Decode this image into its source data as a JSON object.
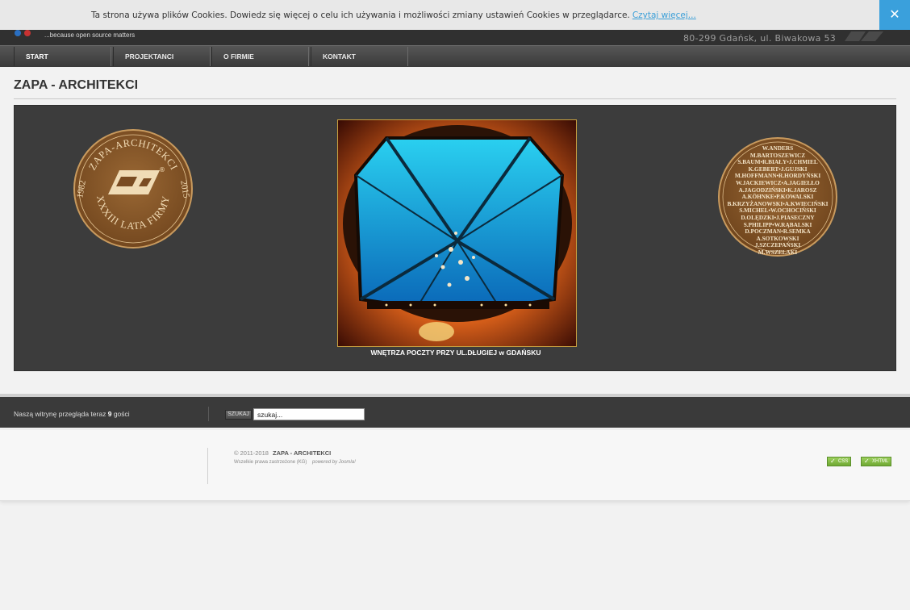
{
  "cookie": {
    "text": "Ta strona używa plików Cookies. Dowiedz się więcej o celu ich używania i możliwości zmiany ustawień Cookies w przeglądarce.",
    "link": "Czytaj więcej...",
    "close": "✕"
  },
  "header": {
    "tagline": "...because open source matters",
    "address": "80-299 Gdańsk, ul. Biwakowa 53"
  },
  "nav": {
    "items": [
      {
        "label": "START"
      },
      {
        "label": "PROJEKTANCI"
      },
      {
        "label": "O FIRMIE"
      },
      {
        "label": "KONTAKT"
      }
    ]
  },
  "main": {
    "title": "ZAPA - ARCHITEKCI",
    "caption": "WNĘTRZA POCZTY PRZY UL.DŁUGIEJ w GDAŃSKU",
    "seal_left": {
      "top_text": "ZAPA-ARCHITEKCI",
      "bottom_text": "XXXIII LATA FIRMY",
      "left_year": "1982",
      "right_year": "2015",
      "mark": "®"
    },
    "seal_right": {
      "names": [
        "W.ANDERS",
        "M.BARTOSZEWICZ",
        "S.BAUM•R.BIAŁY•J.CHMIEL",
        "K.GEBERT•J.GUJSKI",
        "M.HOFFMANN•R.HORDYŃSKI",
        "W.JACKIEWICZ•A.JAGIEŁŁO",
        "A.JAGODZIŃSKI•K.JAROSZ",
        "A.KÖHNKE•P.KOWALSKI",
        "B.KRZYŻANOWSKI•A.KWIECIŃSKI",
        "S.MICHEL•W.OCHOCIŃSKI",
        "D.OLĘDZKI•J.PIASECZNY",
        "S.PHILIPP•W.RĄBALSKI",
        "D.POCZMAN•R.SEMKA",
        "A.SOTKOWSKI",
        "J.SZCZEPAŃSKI",
        "M.WSZELAKI"
      ]
    }
  },
  "footer": {
    "visitors_prefix": "Naszą witrynę przegląda teraz",
    "visitors_count": "9",
    "visitors_suffix": "gości",
    "search_button": "SZUKAJ",
    "search_value": "szukaj...",
    "copyright_years": "© 2011-2018",
    "copyright_name": "ZAPA - ARCHITEKCI",
    "rights": "Wszelkie prawa zastrzeżone (KG)",
    "powered": "powered by Joomla!",
    "badge_css": "CSS",
    "badge_xhtml": "XHTML"
  },
  "colors": {
    "accent": "#3aa0dc",
    "header_bg": "#303030",
    "banner_bg": "#3c3c3c",
    "seal": "#8a5a2c"
  }
}
